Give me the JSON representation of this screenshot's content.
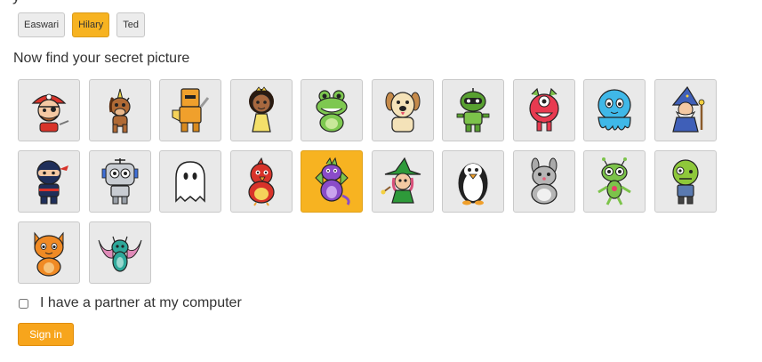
{
  "users": [
    "Easwari",
    "Hilary",
    "Ted"
  ],
  "selected_user": "Hilary",
  "prompt": "Now find your secret picture",
  "pictures": [
    {
      "icon": "pirate-icon"
    },
    {
      "icon": "unicorn-icon"
    },
    {
      "icon": "robot-knight-icon"
    },
    {
      "icon": "princess-icon"
    },
    {
      "icon": "frog-icon"
    },
    {
      "icon": "dog-icon"
    },
    {
      "icon": "green-robot-icon"
    },
    {
      "icon": "red-monster-icon"
    },
    {
      "icon": "blue-octopus-icon"
    },
    {
      "icon": "wizard-icon"
    },
    {
      "icon": "ninja-icon"
    },
    {
      "icon": "silver-robot-icon"
    },
    {
      "icon": "ghost-icon"
    },
    {
      "icon": "red-bird-icon"
    },
    {
      "icon": "purple-dragon-icon"
    },
    {
      "icon": "witch-icon"
    },
    {
      "icon": "penguin-icon"
    },
    {
      "icon": "hamster-icon"
    },
    {
      "icon": "alien-icon"
    },
    {
      "icon": "zombie-icon"
    },
    {
      "icon": "orange-cat-icon"
    },
    {
      "icon": "bat-icon"
    }
  ],
  "selected_picture": "purple-dragon-icon",
  "partner_checkbox": {
    "label": "I have a partner at my computer",
    "checked": false
  },
  "signin_label": "Sign in",
  "colors": {
    "accent": "#f7b321",
    "tile_bg": "#e9e9e9",
    "button": "#f7a51c"
  }
}
